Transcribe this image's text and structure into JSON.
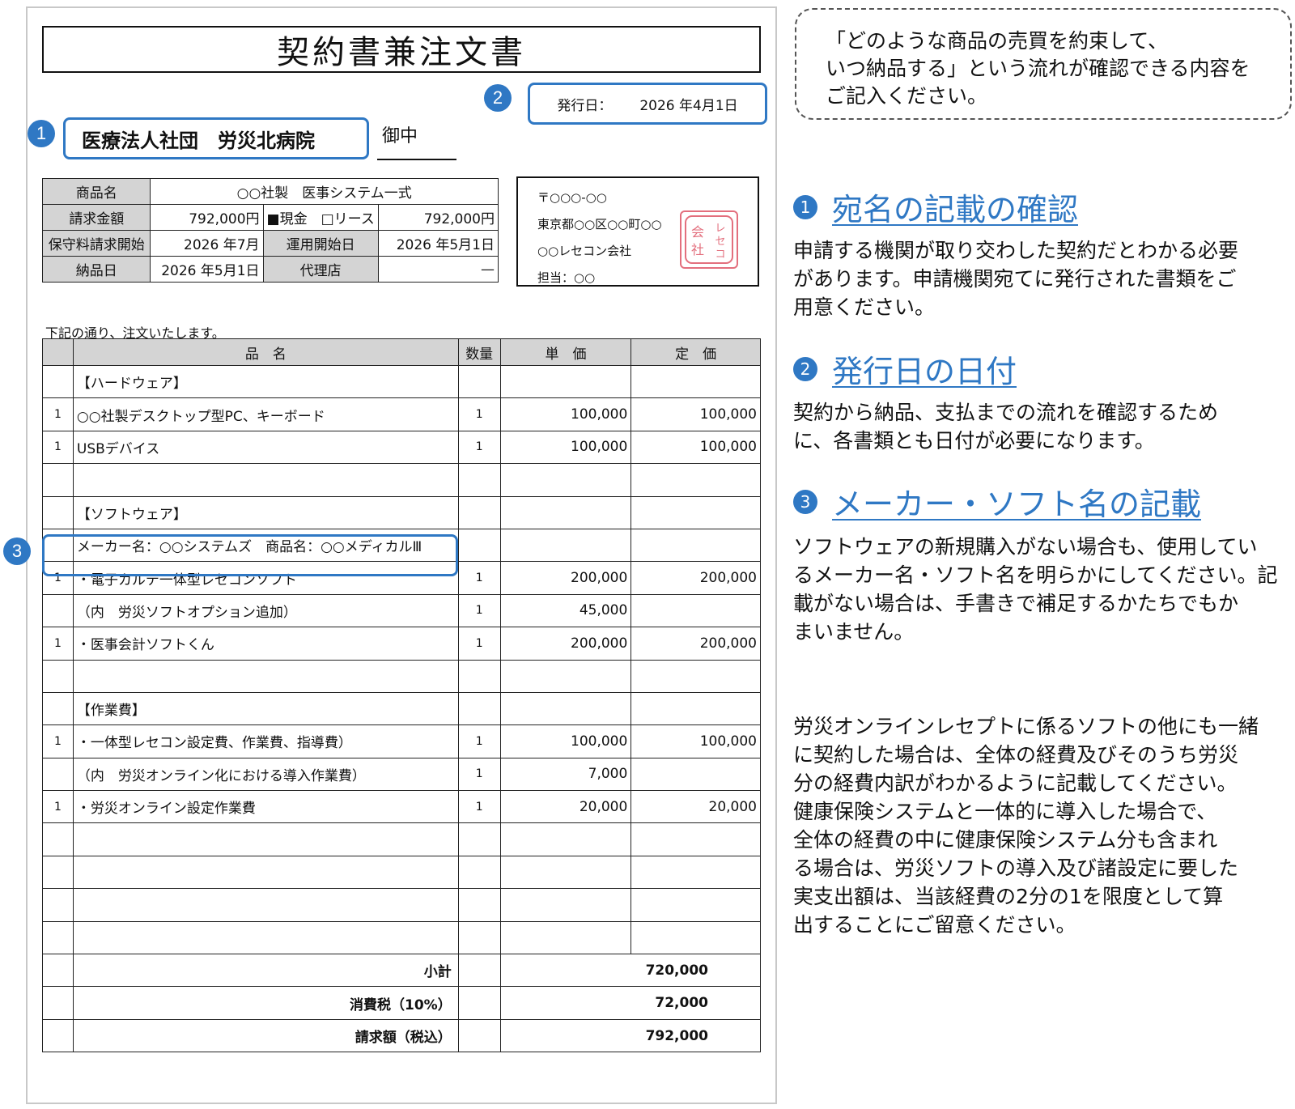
{
  "document": {
    "title": "契約書兼注文書",
    "addressee": "医療法人社団　労災北病院",
    "onchu": "御中",
    "issue_label": "発行日：",
    "issue_date": "2026 年4月1日",
    "markers": [
      "1",
      "2",
      "3"
    ],
    "info": {
      "product_label": "商品名",
      "product_value": "○○社製　医事システム一式",
      "amount_label": "請求金額",
      "amount_value": "792,000円",
      "payment_type": "■現金　□リース",
      "payment_value": "792,000円",
      "maint_label": "保守料請求開始",
      "maint_value": "2026 年7月",
      "op_label": "運用開始日",
      "op_value": "2026 年5月1日",
      "delivery_label": "納品日",
      "delivery_value": "2026 年5月1日",
      "agent_label": "代理店",
      "agent_value": "—"
    },
    "vendor": {
      "postal": "〒○○○-○○",
      "address": "東京都○○区○○町○○",
      "company": "○○レセコン会社",
      "contact": "担当：○○",
      "stamp": "会レセ社コン"
    },
    "order_note": "下記の通り、注文いたします。",
    "table_headers": [
      "品　名",
      "数量",
      "単　価",
      "定　価"
    ],
    "rows": [
      {
        "no": "",
        "name": "【ハードウェア】",
        "qty": "",
        "unit": "",
        "list": ""
      },
      {
        "no": "1",
        "name": "○○社製デスクトップ型PC、キーボード",
        "qty": "1",
        "unit": "100,000",
        "list": "100,000"
      },
      {
        "no": "1",
        "name": "USBデバイス",
        "qty": "1",
        "unit": "100,000",
        "list": "100,000"
      },
      {
        "no": "",
        "name": "",
        "qty": "",
        "unit": "",
        "list": ""
      },
      {
        "no": "",
        "name": "【ソフトウェア】",
        "qty": "",
        "unit": "",
        "list": ""
      },
      {
        "no": "",
        "name": "メーカー名：○○システムズ　商品名：○○メディカルⅢ",
        "qty": "",
        "unit": "",
        "list": ""
      },
      {
        "no": "1",
        "name": "・電子カルテ一体型レセコンソフト",
        "qty": "1",
        "unit": "200,000",
        "list": "200,000"
      },
      {
        "no": "",
        "name": "（内　労災ソフトオプション追加）",
        "qty": "1",
        "unit": "45,000",
        "list": ""
      },
      {
        "no": "1",
        "name": "・医事会計ソフトくん",
        "qty": "1",
        "unit": "200,000",
        "list": "200,000"
      },
      {
        "no": "",
        "name": "",
        "qty": "",
        "unit": "",
        "list": ""
      },
      {
        "no": "",
        "name": "【作業費】",
        "qty": "",
        "unit": "",
        "list": ""
      },
      {
        "no": "1",
        "name": "・一体型レセコン設定費、作業費、指導費）",
        "qty": "1",
        "unit": "100,000",
        "list": "100,000"
      },
      {
        "no": "",
        "name": "（内　労災オンライン化における導入作業費）",
        "qty": "1",
        "unit": "7,000",
        "list": ""
      },
      {
        "no": "1",
        "name": "・労災オンライン設定作業費",
        "qty": "1",
        "unit": "20,000",
        "list": "20,000"
      },
      {
        "no": "",
        "name": "",
        "qty": "",
        "unit": "",
        "list": ""
      },
      {
        "no": "",
        "name": "",
        "qty": "",
        "unit": "",
        "list": ""
      },
      {
        "no": "",
        "name": "",
        "qty": "",
        "unit": "",
        "list": ""
      },
      {
        "no": "",
        "name": "",
        "qty": "",
        "unit": "",
        "list": ""
      }
    ],
    "totals": [
      {
        "label": "小計",
        "value": "720,000"
      },
      {
        "label": "消費税（10%）",
        "value": "72,000"
      },
      {
        "label": "請求額（税込）",
        "value": "792,000"
      }
    ]
  },
  "guide": {
    "callout": [
      "「どのような商品の売買を約束して、",
      "いつ納品する」という流れが確認できる内容を",
      "ご記入ください。"
    ],
    "sections": [
      {
        "num": "1",
        "title": "宛名の記載の確認",
        "body": [
          "申請する機関が取り交わした契約だとわかる必要",
          "があります。申請機関宛てに発行された書類をご",
          "用意ください。"
        ]
      },
      {
        "num": "2",
        "title": "発行日の日付",
        "body": [
          "契約から納品、支払までの流れを確認するため",
          "に、各書類とも日付が必要になります。"
        ]
      },
      {
        "num": "3",
        "title": "メーカー・ソフト名の記載",
        "body": [
          "ソフトウェアの新規購入がない場合も、使用してい",
          "るメーカー名・ソフト名を明らかにしてください。記",
          "載がない場合は、手書きで補足するかたちでもか",
          "まいません。"
        ]
      }
    ],
    "note": [
      "労災オンラインレセプトに係るソフトの他にも一緒",
      "に契約した場合は、全体の経費及びそのうち労災",
      "分の経費内訳がわかるように記載してください。",
      "健康保険システムと一体的に導入した場合で、",
      "全体の経費の中に健康保険システム分も含まれ",
      "る場合は、労災ソフトの導入及び諸設定に要した",
      "実支出額は、当該経費の2分の1を限度として算",
      "出することにご留意ください。"
    ]
  },
  "colors": {
    "accent": "#2f78c4",
    "header_gray": "#d4d4d4",
    "stamp_red": "#e06070"
  }
}
